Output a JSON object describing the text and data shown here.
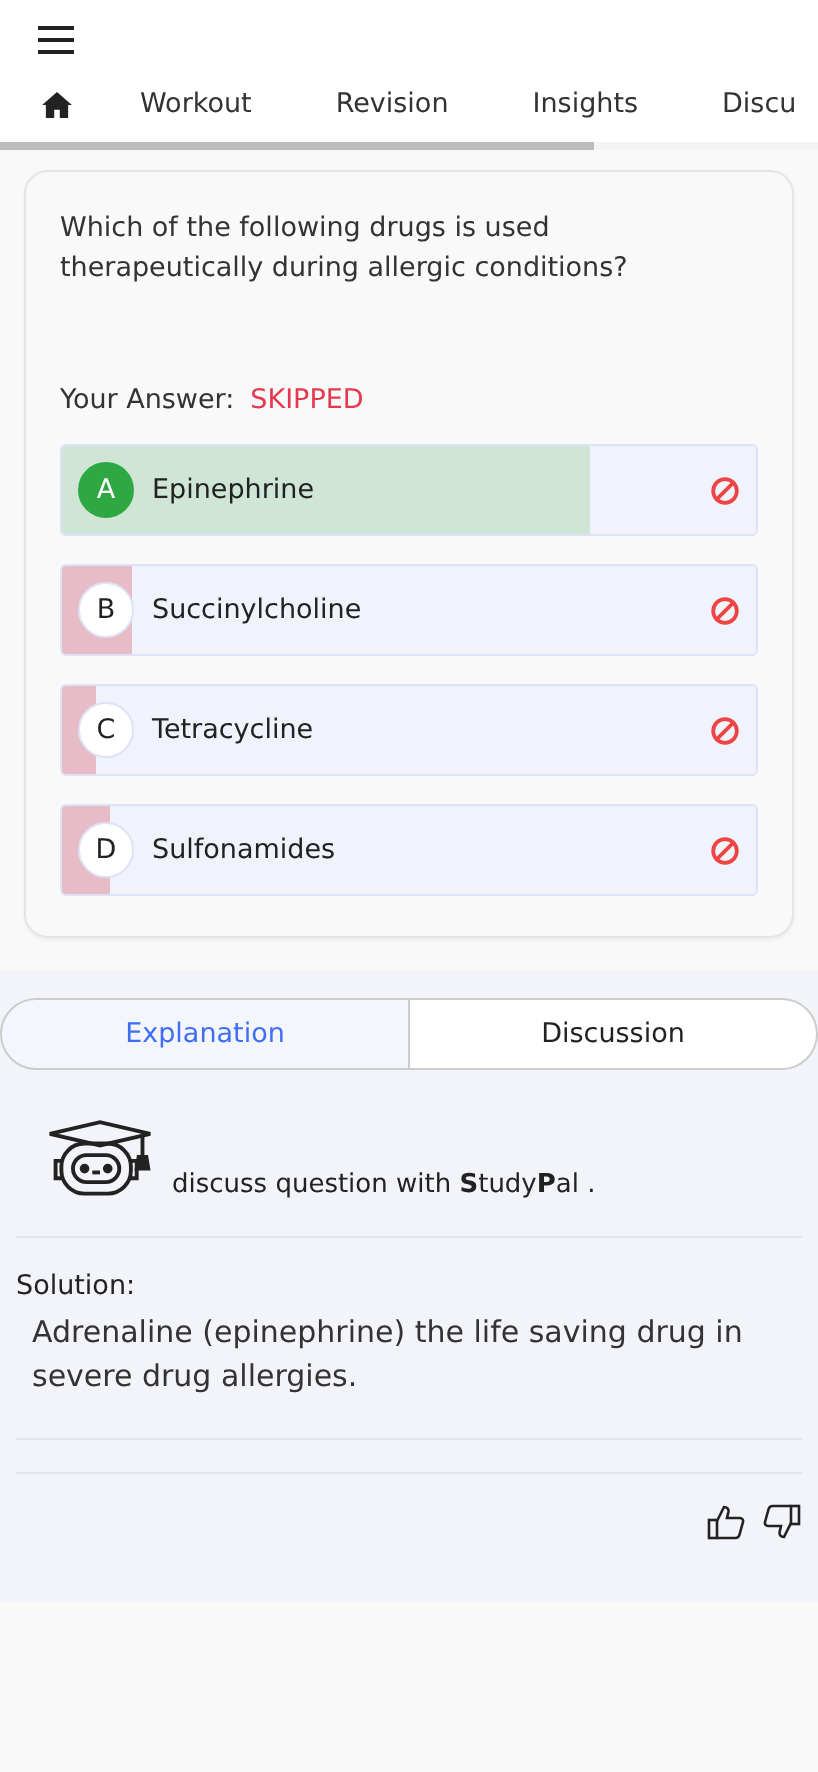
{
  "nav_tabs": [
    {
      "kind": "home"
    },
    {
      "label": "Workout"
    },
    {
      "label": "Revision"
    },
    {
      "label": "Insights"
    },
    {
      "label": "Discu"
    }
  ],
  "question": {
    "text": "Which of the following drugs is used therapeutically during allergic conditions?",
    "answer_label": "Your Answer:",
    "answer_value": "SKIPPED",
    "options": [
      {
        "letter": "A",
        "text": "Epinephrine",
        "correct": true,
        "level": 0.76
      },
      {
        "letter": "B",
        "text": "Succinylcholine",
        "correct": false,
        "level": 0.1
      },
      {
        "letter": "C",
        "text": "Tetracycline",
        "correct": false,
        "level": 0.05
      },
      {
        "letter": "D",
        "text": "Sulfonamides",
        "correct": false,
        "level": 0.07
      }
    ]
  },
  "section_tabs": [
    {
      "label": "Explanation",
      "selected": true
    },
    {
      "label": "Discussion",
      "selected": false
    }
  ],
  "assistant": {
    "text": "discuss question with **S**tudy**P**al ."
  },
  "solution": {
    "label": "Solution:",
    "text": "Adrenaline (epinephrine) the life saving drug in severe drug allergies."
  }
}
